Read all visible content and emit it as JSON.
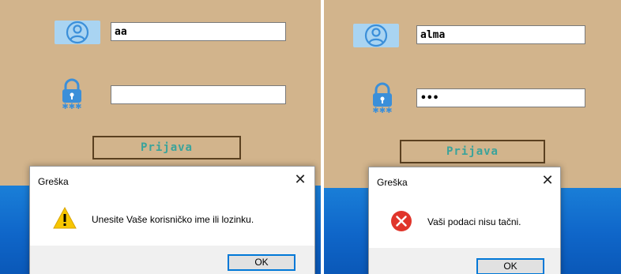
{
  "left": {
    "username_value": "aa",
    "password_value": "",
    "login_label": "Prijava",
    "dialog": {
      "title": "Greška",
      "close_symbol": "✕",
      "message": "Unesite Vaše korisničko ime ili lozinku.",
      "icon": "warning-icon",
      "ok_label": "OK"
    }
  },
  "right": {
    "username_value": "alma",
    "password_value": "•••",
    "login_label": "Prijava",
    "dialog": {
      "title": "Greška",
      "close_symbol": "✕",
      "message": "Vaši podaci nisu tačni.",
      "icon": "error-icon",
      "ok_label": "OK"
    }
  },
  "colors": {
    "form_background": "#d2b48c",
    "login_text": "#3aa39b",
    "login_border": "#5a4020",
    "user_icon_bg": "#a9d4f2",
    "icon_blue": "#3b8fd9",
    "warning_yellow": "#f7c600",
    "error_red": "#e0352b",
    "desktop_blue": "#0f66c9",
    "ok_border": "#0078d7"
  }
}
